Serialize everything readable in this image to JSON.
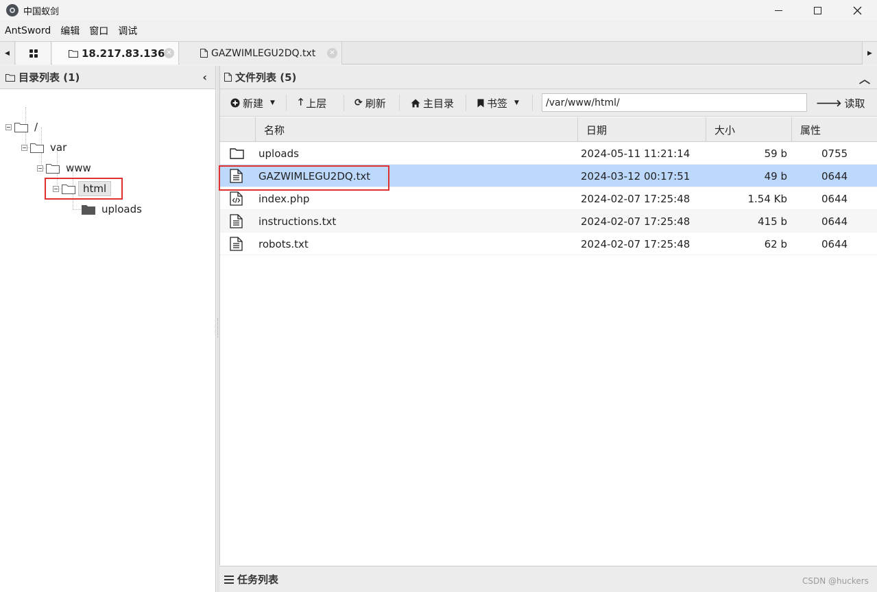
{
  "window": {
    "title": "中国蚁剑"
  },
  "menu": [
    "AntSword",
    "编辑",
    "窗口",
    "调试"
  ],
  "tabs": {
    "host_label": "18.217.83.136",
    "file_label": "GAZWIMLEGU2DQ.txt"
  },
  "dir_panel": {
    "title": "目录列表 (1)",
    "tree": [
      {
        "label": "/"
      },
      {
        "label": "var"
      },
      {
        "label": "www"
      },
      {
        "label": "html"
      },
      {
        "label": "uploads"
      }
    ]
  },
  "file_panel": {
    "title": "文件列表 (5)",
    "toolbar": {
      "new_label": "新建",
      "up_label": "上层",
      "refresh_label": "刷新",
      "home_label": "主目录",
      "bookmark_label": "书签",
      "path_value": "/var/www/html/",
      "read_label": "读取"
    },
    "columns": [
      "名称",
      "日期",
      "大小",
      "属性"
    ],
    "rows": [
      {
        "icon": "folder-icon",
        "name": "uploads",
        "date": "2024-05-11 11:21:14",
        "size": "59 b",
        "attr": "0755"
      },
      {
        "icon": "text-file-icon",
        "name": "GAZWIMLEGU2DQ.txt",
        "date": "2024-03-12 00:17:51",
        "size": "49 b",
        "attr": "0644"
      },
      {
        "icon": "code-file-icon",
        "name": "index.php",
        "date": "2024-02-07 17:25:48",
        "size": "1.54 Kb",
        "attr": "0644"
      },
      {
        "icon": "text-file-icon",
        "name": "instructions.txt",
        "date": "2024-02-07 17:25:48",
        "size": "415 b",
        "attr": "0644"
      },
      {
        "icon": "text-file-icon",
        "name": "robots.txt",
        "date": "2024-02-07 17:25:48",
        "size": "62 b",
        "attr": "0644"
      }
    ]
  },
  "task_panel": {
    "title": "任务列表"
  },
  "watermark": "CSDN @huckers",
  "colors": {
    "selected_row": "#bcd8fc",
    "highlight_box": "#e03030"
  }
}
